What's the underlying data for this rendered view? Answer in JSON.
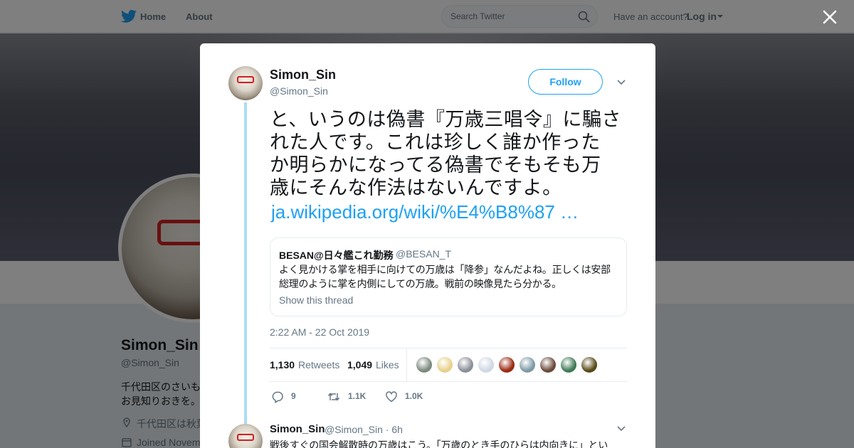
{
  "nav": {
    "home": "Home",
    "about": "About",
    "search_placeholder": "Search Twitter",
    "account_prompt": "Have an account?",
    "login": "Log in"
  },
  "background_profile": {
    "name": "Simon_Sin",
    "handle": "@Simon_Sin",
    "bio_line1": "千代田区のさいも",
    "bio_line2": "お見知りおきを。",
    "location": "千代田区は秋葉",
    "joined": "Joined Novem"
  },
  "tweet": {
    "author_name": "Simon_Sin",
    "author_handle": "@Simon_Sin",
    "follow_label": "Follow",
    "text_lines": [
      "と、いうのは偽書『万歳三唱令』に騙さ",
      "れた人です。これは珍しく誰か作った",
      "か明らかになってる偽書でそもそも万",
      "歳にそんな作法はないんですよ。"
    ],
    "link": "ja.wikipedia.org/wiki/%E4%B8%87 …",
    "timestamp": "2:22 AM - 22 Oct 2019",
    "retweets_count": "1,130",
    "retweets_label": "Retweets",
    "likes_count": "1,049",
    "likes_label": "Likes",
    "actions": {
      "replies": "9",
      "retweets": "1.1K",
      "likes": "1.0K"
    }
  },
  "quote": {
    "name": "BESAN@日々艦これ勤務",
    "handle": "@BESAN_T",
    "text_lines": [
      "よく見かける掌を相手に向けての万歳は「降参」なんだよね。正しくは安部",
      "総理のように掌を内側にしての万歳。戦前の映像見たら分かる。"
    ],
    "show_thread": "Show this thread"
  },
  "likers": [
    "#7c8a7e",
    "#e8d08c",
    "#8b8f99",
    "#cfd8e3",
    "#9b2a12",
    "#7d9aa5",
    "#6a4a3c",
    "#3f7a55",
    "#5a4a18"
  ],
  "reply": {
    "name": "Simon_Sin",
    "meta": "@Simon_Sin · 6h",
    "text": "戦後すぐの国会解散時の万歳はこう。「万歳のとき手のひらは内向きに」とい"
  },
  "colors": {
    "accent": "#1da1f2",
    "thread_line": "#aadcf5",
    "muted": "#657786"
  }
}
